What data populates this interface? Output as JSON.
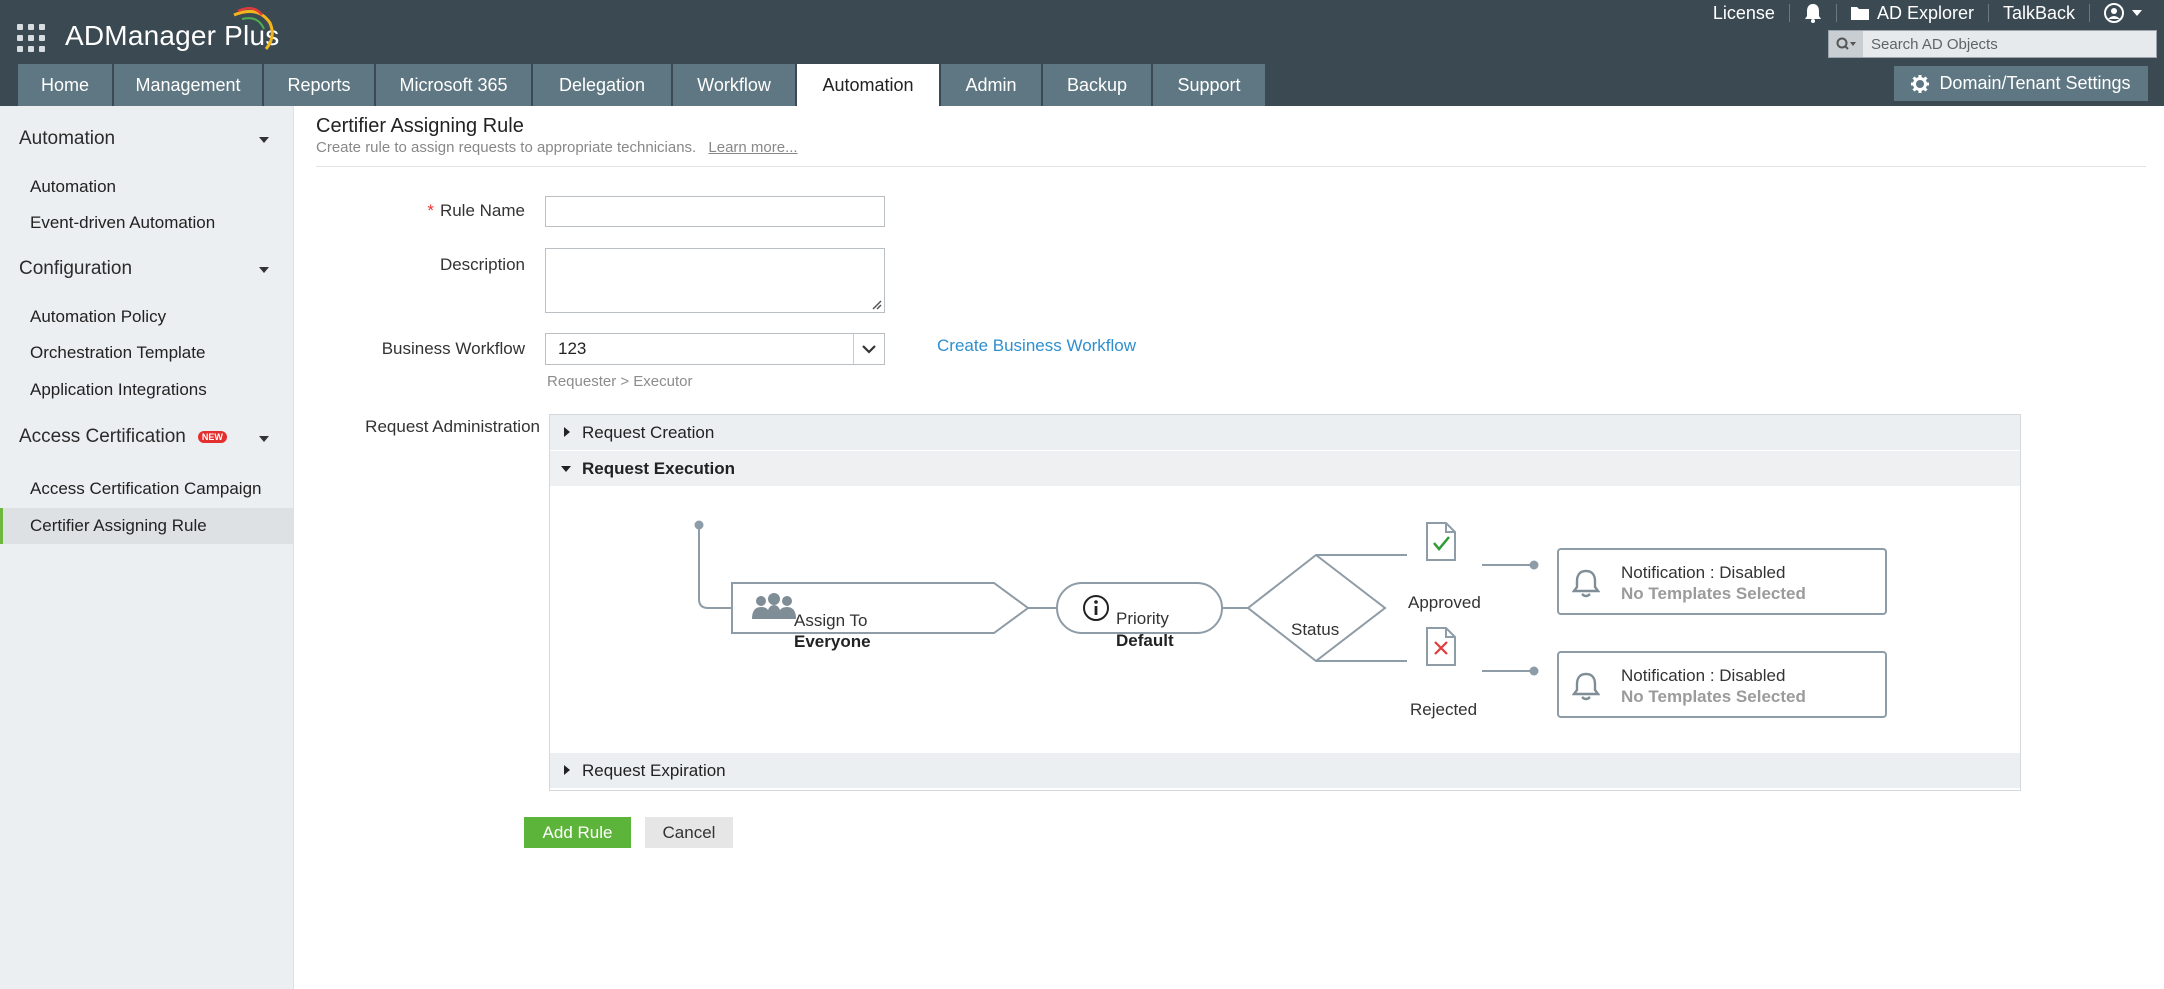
{
  "app": {
    "title": "ADManager Plus"
  },
  "top_links": {
    "license": "License",
    "ad_explorer": "AD Explorer",
    "talkback": "TalkBack"
  },
  "search": {
    "placeholder": "Search AD Objects"
  },
  "nav": {
    "tabs": [
      {
        "label": "Home"
      },
      {
        "label": "Management"
      },
      {
        "label": "Reports"
      },
      {
        "label": "Microsoft 365"
      },
      {
        "label": "Delegation"
      },
      {
        "label": "Workflow"
      },
      {
        "label": "Automation"
      },
      {
        "label": "Admin"
      },
      {
        "label": "Backup"
      },
      {
        "label": "Support"
      }
    ],
    "active": "Automation",
    "domain_settings": "Domain/Tenant Settings"
  },
  "sidebar": {
    "sections": [
      {
        "title": "Automation",
        "items": [
          "Automation",
          "Event-driven Automation"
        ]
      },
      {
        "title": "Configuration",
        "items": [
          "Automation Policy",
          "Orchestration Template",
          "Application Integrations"
        ]
      },
      {
        "title": "Access Certification",
        "badge": "NEW",
        "items": [
          "Access Certification Campaign",
          "Certifier Assigning Rule"
        ]
      }
    ],
    "active_item": "Certifier Assigning Rule"
  },
  "page": {
    "title": "Certifier Assigning Rule",
    "subtitle": "Create rule to assign requests to appropriate technicians.",
    "learn_more": "Learn more..."
  },
  "form": {
    "required_mark": "*",
    "rule_name_label": "Rule Name",
    "rule_name_value": "",
    "description_label": "Description",
    "description_value": "",
    "workflow_label": "Business Workflow",
    "workflow_value": "123",
    "workflow_hint": "Requester > Executor",
    "create_workflow_link": "Create Business Workflow",
    "request_admin_label": "Request Administration"
  },
  "accordion": {
    "creation": "Request Creation",
    "execution": "Request Execution",
    "expiration": "Request Expiration"
  },
  "flow": {
    "assign_label": "Assign To",
    "assign_value": "Everyone",
    "priority_label": "Priority",
    "priority_value": "Default",
    "status": "Status",
    "approved": "Approved",
    "rejected": "Rejected",
    "notif_approved": {
      "line1": "Notification : Disabled",
      "line2": "No Templates Selected"
    },
    "notif_rejected": {
      "line1": "Notification : Disabled",
      "line2": "No Templates Selected"
    }
  },
  "actions": {
    "add": "Add Rule",
    "cancel": "Cancel"
  },
  "colors": {
    "header": "#3a4952",
    "tab": "#5f7782",
    "accent_green": "#5cb53a",
    "link": "#2f8fce",
    "flow_stroke": "#8d9ca6"
  }
}
